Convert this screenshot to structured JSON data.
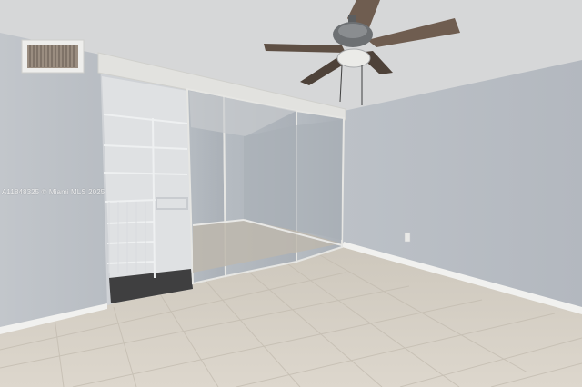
{
  "photo": {
    "subject": "empty bedroom with mirrored closet doors and ceiling fan",
    "watermark_text": "A11848325 © Miami MLS 2025"
  },
  "colors": {
    "wall": "#b9bec4",
    "ceiling": "#d9dadb",
    "floor": "#d6d0c6",
    "baseboard": "#f2f2f0",
    "fan_blade": "#6b5a4d"
  }
}
